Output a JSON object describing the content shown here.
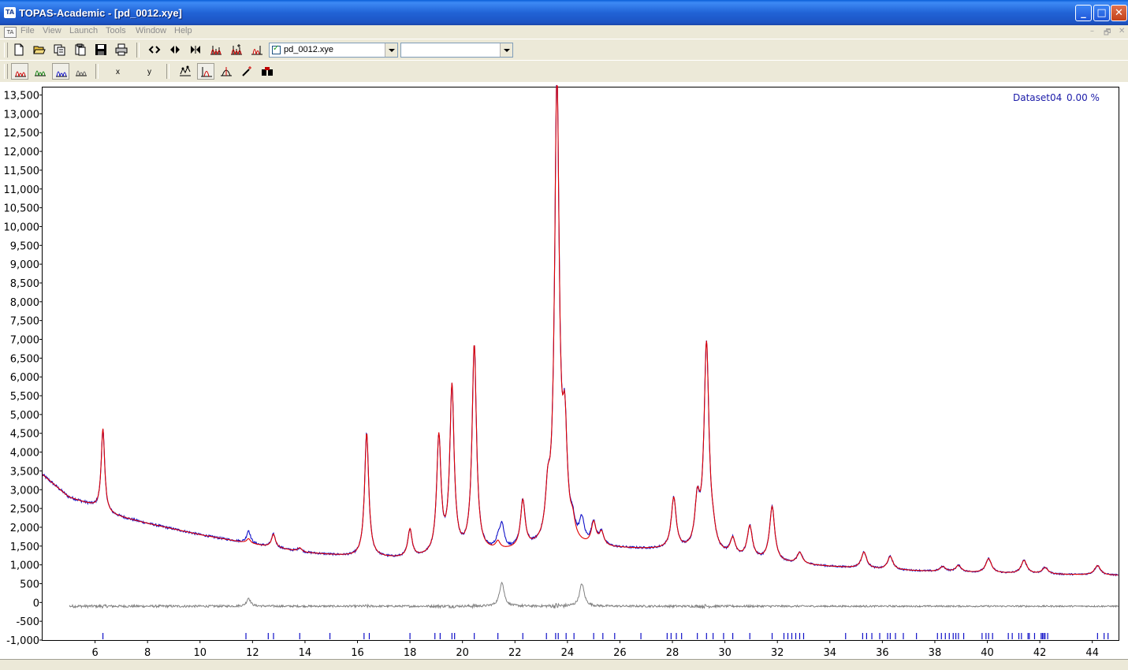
{
  "window": {
    "app_icon_label": "TA",
    "title": "TOPAS-Academic - [pd_0012.xye]",
    "minimize_glyph": "_",
    "maximize_glyph": "□",
    "close_glyph": "✕"
  },
  "menubar": {
    "system_icon_label": "TA",
    "items": [
      "File",
      "View",
      "Launch",
      "Tools",
      "Window",
      "Help"
    ],
    "mdi_minimize": "–",
    "mdi_restore": "🗗",
    "mdi_close": "✕"
  },
  "toolbar1": {
    "icons": [
      "new-file-icon",
      "open-folder-icon",
      "copy-icon",
      "paste-icon",
      "save-icon",
      "print-icon",
      "zoom-horizontal-icon",
      "zoom-horizontal-in-icon",
      "zoom-horizontal-out-icon",
      "peaks-icon",
      "peaks-add-icon",
      "peaks-select-icon"
    ],
    "dataset_checked": true,
    "dataset_value": "pd_0012.xye",
    "second_combo_value": ""
  },
  "toolbar2": {
    "icons": [
      "pattern-red-icon",
      "pattern-green-icon",
      "pattern-blue-icon",
      "pattern-grey-icon",
      "curve-fit-icon",
      "peak-marker-icon",
      "single-peak-icon",
      "magic-wand-icon",
      "binoculars-icon"
    ],
    "x_label": "x",
    "y_label": "y"
  },
  "plot": {
    "dataset_label": "Dataset04",
    "rwp_label": "0.00 %",
    "colors": {
      "observed": "#1010c8",
      "calculated": "#e00000",
      "difference": "#808080",
      "reflections": "#1010c8",
      "axis_text": "#000000",
      "label_text": "#1a1aa8"
    }
  },
  "chart_data": {
    "type": "line",
    "xlim": [
      4.0,
      45.0
    ],
    "ylim": [
      -1000,
      13700
    ],
    "x_ticks": [
      "6",
      "8",
      "10",
      "12",
      "14",
      "16",
      "18",
      "20",
      "22",
      "24",
      "26",
      "28",
      "30",
      "32",
      "34",
      "36",
      "38",
      "40",
      "42",
      "44"
    ],
    "y_ticks": [
      "13,500",
      "13,000",
      "12,500",
      "12,000",
      "11,500",
      "11,000",
      "10,500",
      "10,000",
      "9,500",
      "9,000",
      "8,500",
      "8,000",
      "7,500",
      "7,000",
      "6,500",
      "6,000",
      "5,500",
      "5,000",
      "4,500",
      "4,000",
      "3,500",
      "3,000",
      "2,500",
      "2,000",
      "1,500",
      "1,000",
      "500",
      "0",
      "-500",
      "-1,000"
    ],
    "y_tick_values": [
      13500,
      13000,
      12500,
      12000,
      11500,
      11000,
      10500,
      10000,
      9500,
      9000,
      8500,
      8000,
      7500,
      7000,
      6500,
      6000,
      5500,
      5000,
      4500,
      4000,
      3500,
      3000,
      2500,
      2000,
      1500,
      1000,
      500,
      0,
      -500,
      -1000
    ],
    "x_tick_values": [
      6,
      8,
      10,
      12,
      14,
      16,
      18,
      20,
      22,
      24,
      26,
      28,
      30,
      32,
      34,
      36,
      38,
      40,
      42,
      44
    ],
    "background_points": [
      [
        4.0,
        3400
      ],
      [
        5.0,
        2800
      ],
      [
        5.8,
        2600
      ],
      [
        6.5,
        2350
      ],
      [
        8,
        2100
      ],
      [
        10,
        1800
      ],
      [
        12,
        1550
      ],
      [
        14,
        1320
      ],
      [
        16,
        1200
      ],
      [
        18,
        1150
      ],
      [
        20,
        1250
      ],
      [
        22,
        1350
      ],
      [
        24,
        1420
      ],
      [
        26,
        1420
      ],
      [
        28,
        1380
      ],
      [
        30,
        1200
      ],
      [
        32,
        1050
      ],
      [
        34,
        950
      ],
      [
        36,
        870
      ],
      [
        38,
        820
      ],
      [
        40,
        780
      ],
      [
        42,
        750
      ],
      [
        45,
        720
      ]
    ],
    "peaks": [
      {
        "x": 6.3,
        "height": 2200
      },
      {
        "x": 11.85,
        "height": 120
      },
      {
        "x": 12.8,
        "height": 350
      },
      {
        "x": 13.8,
        "height": 100
      },
      {
        "x": 16.35,
        "height": 3300
      },
      {
        "x": 18.0,
        "height": 750
      },
      {
        "x": 19.1,
        "height": 3100
      },
      {
        "x": 19.6,
        "height": 4400
      },
      {
        "x": 20.45,
        "height": 5500
      },
      {
        "x": 21.35,
        "height": 200
      },
      {
        "x": 22.3,
        "height": 1250
      },
      {
        "x": 23.25,
        "height": 1100
      },
      {
        "x": 23.6,
        "height": 12300
      },
      {
        "x": 23.9,
        "height": 2700
      },
      {
        "x": 24.2,
        "height": 400
      },
      {
        "x": 25.0,
        "height": 600
      },
      {
        "x": 25.3,
        "height": 350
      },
      {
        "x": 28.05,
        "height": 1350
      },
      {
        "x": 28.95,
        "height": 1200
      },
      {
        "x": 29.3,
        "height": 5500
      },
      {
        "x": 29.55,
        "height": 300
      },
      {
        "x": 30.3,
        "height": 450
      },
      {
        "x": 30.95,
        "height": 850
      },
      {
        "x": 31.8,
        "height": 1450
      },
      {
        "x": 32.85,
        "height": 300
      },
      {
        "x": 35.3,
        "height": 430
      },
      {
        "x": 36.3,
        "height": 350
      },
      {
        "x": 38.3,
        "height": 130
      },
      {
        "x": 38.9,
        "height": 170
      },
      {
        "x": 40.05,
        "height": 380
      },
      {
        "x": 41.4,
        "height": 350
      },
      {
        "x": 42.2,
        "height": 170
      },
      {
        "x": 44.2,
        "height": 250
      }
    ],
    "observed_extra_peaks": [
      {
        "x": 11.85,
        "height": 220
      },
      {
        "x": 21.5,
        "height": 650
      },
      {
        "x": 24.55,
        "height": 600
      }
    ],
    "difference_offset": -100,
    "reflection_ticks": [
      6.3,
      11.75,
      12.6,
      12.8,
      13.8,
      14.95,
      16.25,
      16.45,
      18.0,
      18.95,
      19.15,
      19.6,
      19.7,
      20.45,
      21.35,
      22.3,
      23.2,
      23.55,
      23.65,
      23.95,
      24.25,
      25.0,
      25.35,
      25.8,
      26.8,
      27.8,
      27.95,
      28.15,
      28.35,
      28.95,
      29.3,
      29.55,
      29.95,
      30.3,
      30.95,
      31.8,
      32.25,
      32.4,
      32.55,
      32.7,
      32.85,
      33.0,
      34.6,
      35.25,
      35.4,
      35.6,
      35.9,
      36.2,
      36.3,
      36.5,
      36.8,
      37.3,
      38.1,
      38.25,
      38.4,
      38.55,
      38.7,
      38.8,
      38.9,
      39.1,
      39.8,
      39.95,
      40.05,
      40.2,
      40.8,
      40.95,
      41.2,
      41.3,
      41.55,
      41.6,
      41.8,
      42.05,
      42.1,
      42.15,
      42.2,
      42.3,
      44.2,
      44.45,
      44.6
    ]
  }
}
